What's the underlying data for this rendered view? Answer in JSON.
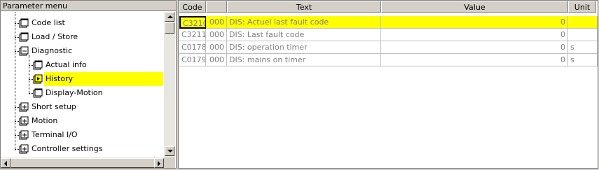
{
  "left_panel": {
    "title": "Parameter menu",
    "items": [
      {
        "label": "Code list",
        "icon": "page-icon"
      },
      {
        "label": "Load / Store",
        "icon": "page-icon"
      },
      {
        "label": "Diagnostic",
        "icon": "minus-box-icon"
      },
      {
        "label": "Actual info",
        "icon": "page-icon"
      },
      {
        "label": "History",
        "icon": "arrow-page-icon",
        "selected": true
      },
      {
        "label": "Display-Motion",
        "icon": "page-icon"
      },
      {
        "label": "Short setup",
        "icon": "plus-box-icon"
      },
      {
        "label": "Motion",
        "icon": "plus-box-icon"
      },
      {
        "label": "Terminal I/O",
        "icon": "plus-box-icon"
      },
      {
        "label": "Controller settings",
        "icon": "plus-box-icon"
      }
    ]
  },
  "table": {
    "headers": {
      "code": "Code",
      "sub": "",
      "text": "Text",
      "value": "Value",
      "unit": "Unit"
    },
    "rows": [
      {
        "code": "C3210",
        "sub": "000",
        "text": "DIS: Actuel last fault code",
        "value": "0",
        "unit": "",
        "highlight": true
      },
      {
        "code": "C3211",
        "sub": "000",
        "text": "DIS: Last fault code",
        "value": "0",
        "unit": ""
      },
      {
        "code": "C0178",
        "sub": "000",
        "text": "DIS: operation timer",
        "value": "0",
        "unit": "s"
      },
      {
        "code": "C0179",
        "sub": "000",
        "text": "DIS: mains on timer",
        "value": "0",
        "unit": "s"
      }
    ]
  },
  "colors": {
    "highlight": "#ffff00",
    "panel": "#d4d0c8"
  }
}
